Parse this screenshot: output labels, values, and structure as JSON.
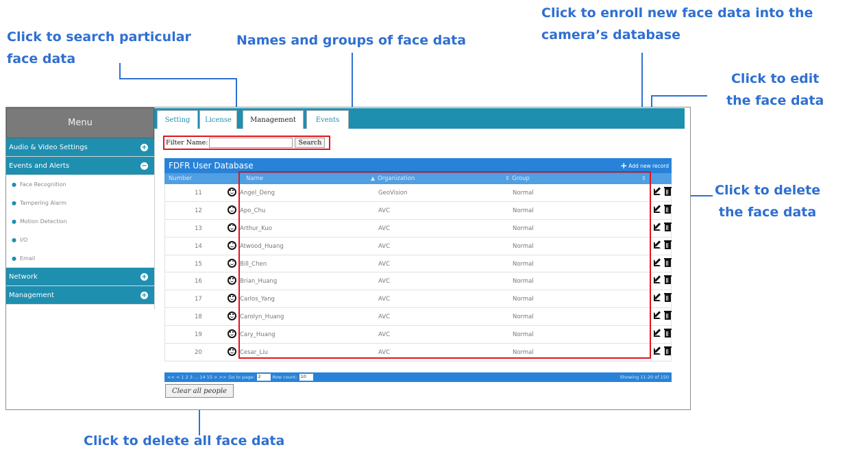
{
  "callouts": {
    "search": [
      "Click to search particular",
      "face data"
    ],
    "names": "Names and groups of face data",
    "enroll": [
      "Click to enroll new face data into the",
      "camera’s database"
    ],
    "edit": [
      "Click to edit",
      "the  face data"
    ],
    "delete": [
      "Click to delete",
      "the  face data"
    ],
    "clear_all": "Click to delete all face data"
  },
  "sidebar": {
    "title": "Menu",
    "sections": [
      {
        "label": "Audio & Video Settings",
        "expand_icon": "+"
      },
      {
        "label": "Events and Alerts",
        "expand_icon": "−"
      }
    ],
    "sub_items": [
      "Face Recognition",
      "Tampering Alarm",
      "Motion Detection",
      "I/O",
      "Email"
    ],
    "bottom_sections": [
      {
        "label": "Network",
        "expand_icon": "+"
      },
      {
        "label": "Management",
        "expand_icon": "+"
      }
    ]
  },
  "tabs": [
    "Setting",
    "License",
    "Management",
    "Events"
  ],
  "active_tab": "Management",
  "filter": {
    "label": "Filter Name:",
    "value": "",
    "button": "Search"
  },
  "grid": {
    "title": "FDFR User Database",
    "add_label": "Add new record",
    "columns": [
      "Number",
      "Name",
      "Organization",
      "Group"
    ],
    "rows": [
      {
        "number": "11",
        "name": "Angel_Deng",
        "organization": "GeoVision",
        "group": "Normal"
      },
      {
        "number": "12",
        "name": "Apo_Chu",
        "organization": "AVC",
        "group": "Normal"
      },
      {
        "number": "13",
        "name": "Arthur_Kuo",
        "organization": "AVC",
        "group": "Normal"
      },
      {
        "number": "14",
        "name": "Atwood_Huang",
        "organization": "AVC",
        "group": "Normal"
      },
      {
        "number": "15",
        "name": "Bill_Chen",
        "organization": "AVC",
        "group": "Normal"
      },
      {
        "number": "16",
        "name": "Brian_Huang",
        "organization": "AVC",
        "group": "Normal"
      },
      {
        "number": "17",
        "name": "Carlos_Yang",
        "organization": "AVC",
        "group": "Normal"
      },
      {
        "number": "18",
        "name": "Carolyn_Huang",
        "organization": "AVC",
        "group": "Normal"
      },
      {
        "number": "19",
        "name": "Cary_Huang",
        "organization": "AVC",
        "group": "Normal"
      },
      {
        "number": "20",
        "name": "Cesar_Liu",
        "organization": "AVC",
        "group": "Normal"
      }
    ]
  },
  "pager": {
    "nav": "<<  <  1  2  3  ...  14  15  >  >>",
    "goto_label": "Go to page:",
    "page": "2",
    "rowcount_label": "Row count:",
    "rowcount": "10",
    "showing": "Showing 11-20 of 150"
  },
  "clear_button": "Clear all people",
  "colors": {
    "accent": "#1f8fb0",
    "grid_blue": "#2883d8",
    "callout": "#2f6fd1",
    "highlight": "#e0141e"
  }
}
